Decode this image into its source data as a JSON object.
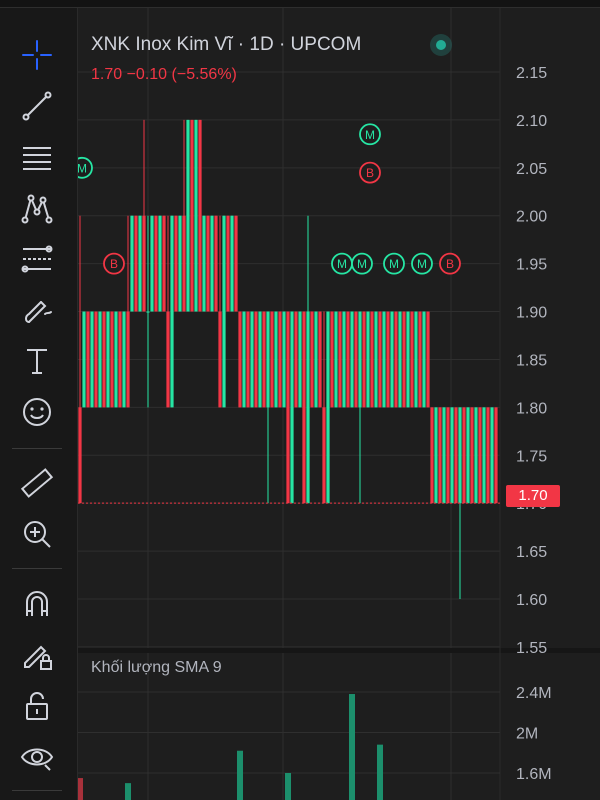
{
  "header": {
    "symbol_line": "XNK Inox Kim Vĩ · 1D · UPCOM",
    "price_line": "1.70  −0.10 (−5.56%)"
  },
  "toolbar": {
    "tools": [
      {
        "name": "crosshair-icon",
        "active": true
      },
      {
        "name": "trend-line-icon"
      },
      {
        "name": "horizontal-lines-icon"
      },
      {
        "name": "pattern-icon"
      },
      {
        "name": "fib-lines-icon"
      },
      {
        "name": "brush-icon"
      },
      {
        "name": "text-icon"
      },
      {
        "name": "emoji-icon"
      },
      {
        "name": "ruler-icon"
      },
      {
        "name": "zoom-in-icon"
      },
      {
        "name": "magnet-icon"
      },
      {
        "name": "lock-pencil-icon"
      },
      {
        "name": "unlock-icon"
      },
      {
        "name": "eye-icon"
      }
    ]
  },
  "colors": {
    "up": "#26e6a4",
    "down": "#f23645",
    "accent": "#2962ff",
    "grid": "#2f2f2f"
  },
  "volume_panel": {
    "label": "Khối lượng SMA 9",
    "axis_ticks": [
      "2.4M",
      "2M",
      "1.6M"
    ]
  },
  "chart_data": {
    "type": "candlestick",
    "y_ticks": [
      2.15,
      2.1,
      2.05,
      2.0,
      1.95,
      1.9,
      1.85,
      1.8,
      1.75,
      1.7,
      1.65,
      1.6,
      1.55
    ],
    "ylim": [
      1.55,
      2.15
    ],
    "last_price": 1.7,
    "last_price_label": "1.70",
    "candles": [
      [
        1.8,
        2.0,
        1.7,
        1.7
      ],
      [
        1.8,
        1.9,
        1.8,
        1.9
      ],
      [
        1.9,
        1.9,
        1.8,
        1.8
      ],
      [
        1.8,
        1.9,
        1.8,
        1.9
      ],
      [
        1.9,
        1.9,
        1.8,
        1.8
      ],
      [
        1.8,
        1.9,
        1.8,
        1.9
      ],
      [
        1.9,
        1.9,
        1.8,
        1.8
      ],
      [
        1.8,
        1.9,
        1.8,
        1.9
      ],
      [
        1.9,
        1.9,
        1.8,
        1.8
      ],
      [
        1.8,
        1.9,
        1.8,
        1.9
      ],
      [
        1.9,
        1.9,
        1.8,
        1.8
      ],
      [
        1.8,
        1.9,
        1.8,
        1.9
      ],
      [
        1.9,
        2.0,
        1.8,
        1.8
      ],
      [
        1.9,
        2.0,
        1.9,
        2.0
      ],
      [
        2.0,
        2.0,
        1.9,
        1.9
      ],
      [
        1.9,
        2.0,
        1.9,
        2.0
      ],
      [
        2.0,
        2.1,
        1.9,
        1.9
      ],
      [
        1.9,
        2.0,
        1.8,
        1.9
      ],
      [
        1.9,
        2.0,
        1.9,
        2.0
      ],
      [
        2.0,
        2.0,
        1.9,
        1.9
      ],
      [
        1.9,
        2.0,
        1.9,
        2.0
      ],
      [
        2.0,
        2.0,
        1.9,
        1.9
      ],
      [
        1.9,
        2.0,
        1.8,
        1.8
      ],
      [
        1.8,
        2.0,
        1.8,
        2.0
      ],
      [
        2.0,
        2.0,
        1.9,
        1.9
      ],
      [
        1.9,
        2.0,
        1.9,
        2.0
      ],
      [
        2.0,
        2.1,
        1.9,
        1.9
      ],
      [
        1.9,
        2.1,
        1.9,
        2.1
      ],
      [
        2.1,
        2.1,
        1.9,
        1.9
      ],
      [
        1.9,
        2.1,
        1.9,
        2.1
      ],
      [
        2.1,
        2.1,
        1.9,
        1.9
      ],
      [
        1.9,
        2.0,
        1.9,
        2.0
      ],
      [
        2.0,
        2.0,
        1.9,
        1.9
      ],
      [
        1.9,
        2.0,
        1.9,
        2.0
      ],
      [
        2.0,
        2.0,
        1.9,
        1.9
      ],
      [
        1.9,
        2.0,
        1.8,
        1.8
      ],
      [
        1.8,
        2.0,
        1.8,
        2.0
      ],
      [
        2.0,
        2.0,
        1.9,
        1.9
      ],
      [
        1.9,
        2.0,
        1.9,
        2.0
      ],
      [
        2.0,
        2.0,
        1.9,
        1.9
      ],
      [
        1.9,
        1.9,
        1.8,
        1.8
      ],
      [
        1.8,
        1.9,
        1.8,
        1.9
      ],
      [
        1.9,
        1.9,
        1.8,
        1.8
      ],
      [
        1.8,
        1.9,
        1.8,
        1.9
      ],
      [
        1.9,
        1.9,
        1.8,
        1.8
      ],
      [
        1.8,
        1.9,
        1.8,
        1.9
      ],
      [
        1.9,
        1.9,
        1.8,
        1.8
      ],
      [
        1.8,
        1.9,
        1.7,
        1.9
      ],
      [
        1.9,
        1.9,
        1.8,
        1.8
      ],
      [
        1.8,
        1.9,
        1.8,
        1.9
      ],
      [
        1.9,
        1.9,
        1.8,
        1.8
      ],
      [
        1.8,
        1.9,
        1.8,
        1.9
      ],
      [
        1.9,
        1.9,
        1.7,
        1.7
      ],
      [
        1.7,
        1.9,
        1.7,
        1.9
      ],
      [
        1.9,
        1.9,
        1.8,
        1.8
      ],
      [
        1.8,
        1.9,
        1.8,
        1.9
      ],
      [
        1.9,
        1.9,
        1.7,
        1.7
      ],
      [
        1.7,
        2.0,
        1.7,
        1.9
      ],
      [
        1.9,
        1.9,
        1.8,
        1.8
      ],
      [
        1.8,
        1.9,
        1.8,
        1.9
      ],
      [
        1.9,
        1.9,
        1.8,
        1.8
      ],
      [
        1.8,
        1.9,
        1.7,
        1.7
      ],
      [
        1.7,
        1.9,
        1.7,
        1.9
      ],
      [
        1.9,
        1.9,
        1.8,
        1.8
      ],
      [
        1.8,
        1.9,
        1.8,
        1.9
      ],
      [
        1.9,
        1.9,
        1.8,
        1.8
      ],
      [
        1.8,
        1.9,
        1.8,
        1.9
      ],
      [
        1.9,
        1.9,
        1.8,
        1.8
      ],
      [
        1.8,
        1.9,
        1.8,
        1.9
      ],
      [
        1.9,
        1.9,
        1.8,
        1.8
      ],
      [
        1.8,
        1.9,
        1.7,
        1.9
      ],
      [
        1.9,
        1.9,
        1.8,
        1.8
      ],
      [
        1.8,
        1.9,
        1.8,
        1.9
      ],
      [
        1.9,
        1.9,
        1.8,
        1.8
      ],
      [
        1.8,
        1.9,
        1.8,
        1.9
      ],
      [
        1.9,
        1.9,
        1.8,
        1.8
      ],
      [
        1.8,
        1.9,
        1.8,
        1.9
      ],
      [
        1.9,
        1.9,
        1.8,
        1.8
      ],
      [
        1.8,
        1.9,
        1.8,
        1.9
      ],
      [
        1.9,
        1.9,
        1.8,
        1.8
      ],
      [
        1.8,
        1.9,
        1.8,
        1.9
      ],
      [
        1.9,
        1.9,
        1.8,
        1.8
      ],
      [
        1.8,
        1.9,
        1.8,
        1.9
      ],
      [
        1.9,
        1.9,
        1.8,
        1.8
      ],
      [
        1.8,
        1.9,
        1.8,
        1.9
      ],
      [
        1.9,
        1.9,
        1.8,
        1.8
      ],
      [
        1.8,
        1.9,
        1.8,
        1.9
      ],
      [
        1.9,
        1.9,
        1.8,
        1.8
      ],
      [
        1.8,
        1.8,
        1.7,
        1.7
      ],
      [
        1.7,
        1.8,
        1.7,
        1.8
      ],
      [
        1.8,
        1.8,
        1.7,
        1.7
      ],
      [
        1.7,
        1.8,
        1.7,
        1.8
      ],
      [
        1.8,
        1.8,
        1.7,
        1.7
      ],
      [
        1.7,
        1.8,
        1.7,
        1.8
      ],
      [
        1.8,
        1.8,
        1.7,
        1.7
      ],
      [
        1.7,
        1.8,
        1.6,
        1.8
      ],
      [
        1.8,
        1.8,
        1.7,
        1.7
      ],
      [
        1.7,
        1.8,
        1.7,
        1.8
      ],
      [
        1.8,
        1.8,
        1.7,
        1.7
      ],
      [
        1.7,
        1.8,
        1.7,
        1.8
      ],
      [
        1.8,
        1.8,
        1.7,
        1.7
      ],
      [
        1.7,
        1.8,
        1.7,
        1.8
      ],
      [
        1.8,
        1.8,
        1.7,
        1.7
      ],
      [
        1.7,
        1.8,
        1.7,
        1.8
      ],
      [
        1.8,
        1.8,
        1.7,
        1.7
      ]
    ],
    "markers": [
      {
        "label": "M",
        "type": "up",
        "index": 0,
        "price": 2.05
      },
      {
        "label": "B",
        "type": "down",
        "index": 8,
        "price": 1.95
      },
      {
        "label": "M",
        "type": "up",
        "index": 72,
        "price": 2.085
      },
      {
        "label": "B",
        "type": "down",
        "index": 72,
        "price": 2.045
      },
      {
        "label": "M",
        "type": "up",
        "index": 65,
        "price": 1.95
      },
      {
        "label": "M",
        "type": "up",
        "index": 70,
        "price": 1.95
      },
      {
        "label": "M",
        "type": "up",
        "index": 78,
        "price": 1.95
      },
      {
        "label": "M",
        "type": "up",
        "index": 85,
        "price": 1.95
      },
      {
        "label": "B",
        "type": "down",
        "index": 92,
        "price": 1.95
      }
    ],
    "volume": {
      "ylim": [
        1.2,
        2.6
      ],
      "bars": [
        {
          "index": 0,
          "value": 1.55,
          "type": "down"
        },
        {
          "index": 12,
          "value": 1.5,
          "type": "up"
        },
        {
          "index": 40,
          "value": 1.82,
          "type": "up"
        },
        {
          "index": 52,
          "value": 1.6,
          "type": "up"
        },
        {
          "index": 68,
          "value": 2.38,
          "type": "up"
        },
        {
          "index": 75,
          "value": 1.88,
          "type": "up"
        }
      ]
    }
  }
}
